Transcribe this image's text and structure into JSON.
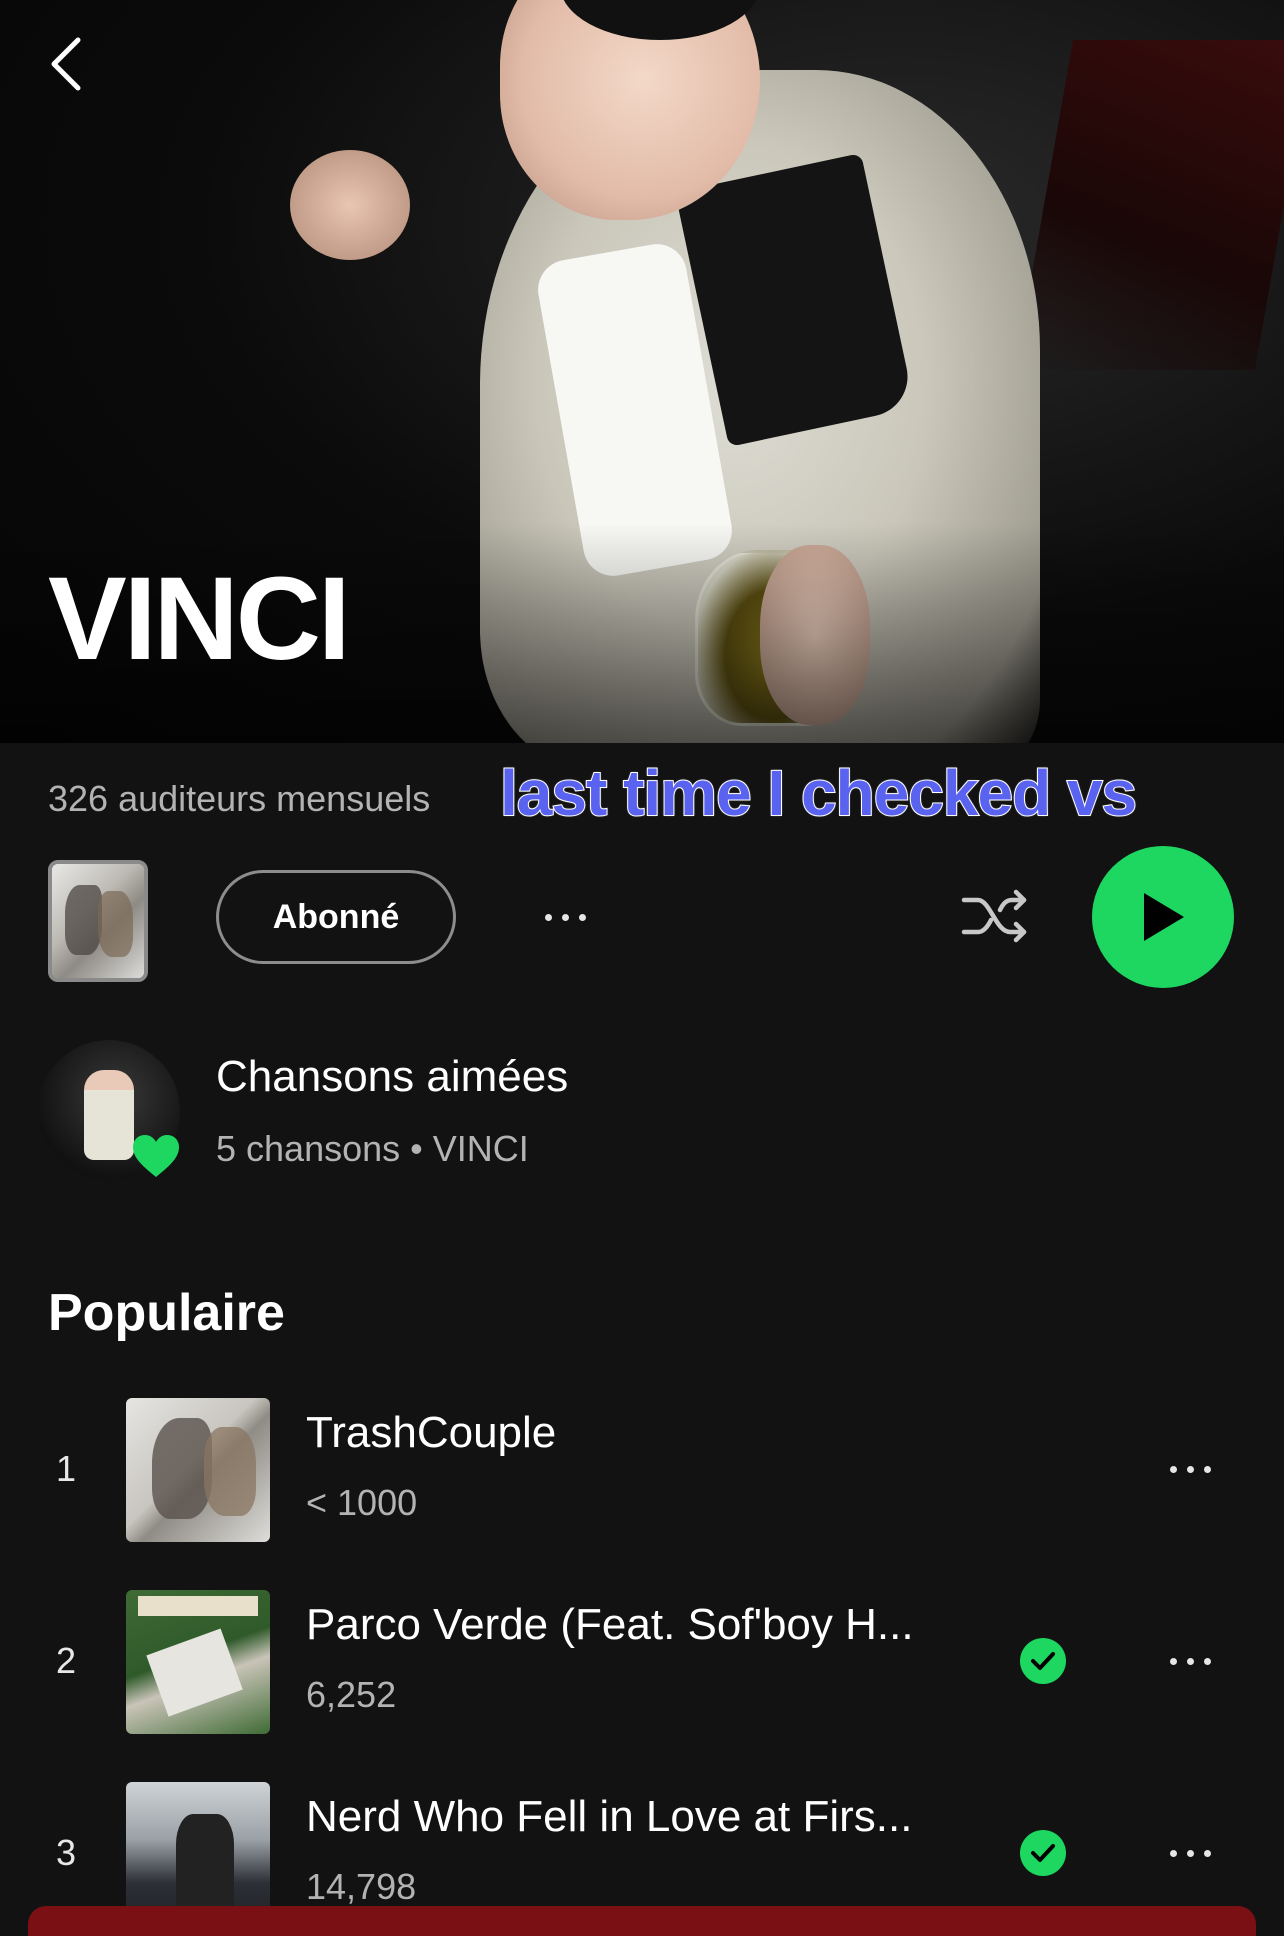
{
  "header": {
    "artist_name": "VINCI",
    "monthly_listeners": "326 auditeurs mensuels",
    "overlay_caption": "last time I checked vs"
  },
  "actions": {
    "follow_label": "Abonné"
  },
  "liked_songs": {
    "title": "Chansons aimées",
    "subtitle": "5 chansons • VINCI"
  },
  "popular": {
    "title": "Populaire",
    "tracks": [
      {
        "rank": "1",
        "title": "TrashCouple",
        "plays": "< 1000",
        "downloaded": false
      },
      {
        "rank": "2",
        "title": "Parco Verde (Feat. Sof'boy H...",
        "plays": "6,252",
        "downloaded": true
      },
      {
        "rank": "3",
        "title": "Nerd Who Fell in Love at Firs...",
        "plays": "14,798",
        "downloaded": true
      }
    ]
  },
  "colors": {
    "accent": "#1ed760",
    "background": "#121212",
    "caption": "#5a63f0"
  },
  "icons": {
    "back": "chevron-left-icon",
    "more": "more-dots-icon",
    "shuffle": "shuffle-icon",
    "play": "play-icon",
    "heart": "heart-icon",
    "downloaded": "check-circle-icon"
  }
}
